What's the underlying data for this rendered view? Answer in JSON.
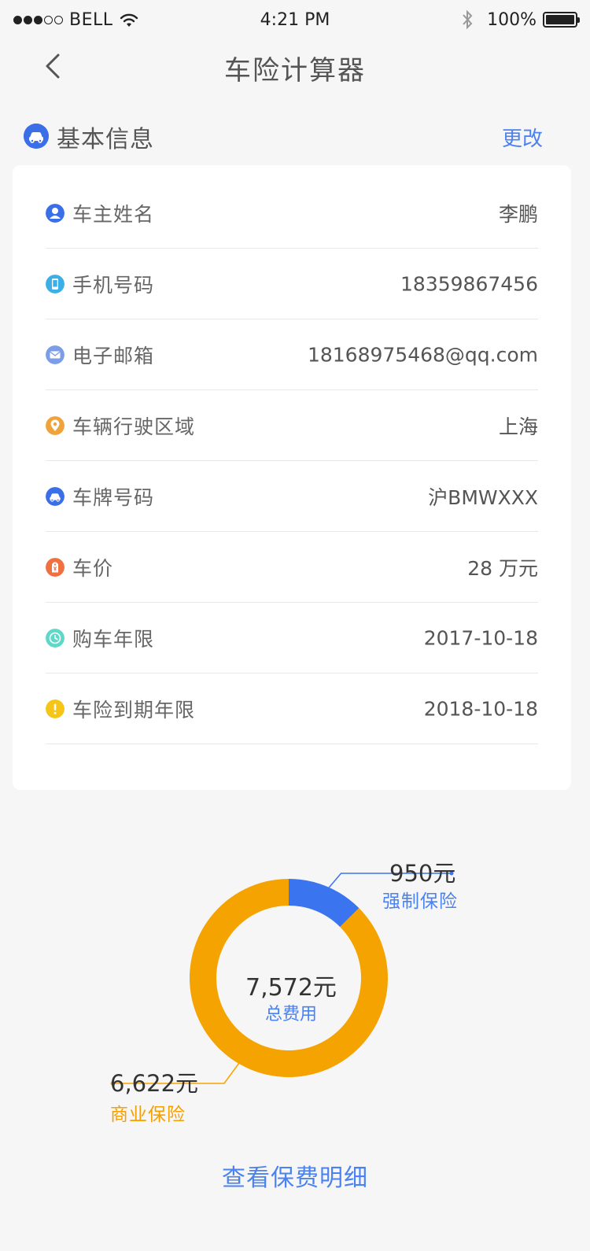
{
  "status_bar": {
    "carrier": "BELL",
    "time": "4:21 PM",
    "battery": "100%",
    "signal_filled": 3,
    "signal_total": 5
  },
  "nav": {
    "title": "车险计算器",
    "back_icon": "chevron-left-icon"
  },
  "section": {
    "title": "基本信息",
    "edit_label": "更改",
    "icon": "car-icon"
  },
  "rows": [
    {
      "label": "车主姓名",
      "value": "李鹏",
      "icon": "user-icon",
      "color": "#3a6fe8"
    },
    {
      "label": "手机号码",
      "value": "18359867456",
      "icon": "phone-icon",
      "color": "#3cb0e6"
    },
    {
      "label": "电子邮箱",
      "value": "18168975468@qq.com",
      "icon": "mail-icon",
      "color": "#7c9ee8"
    },
    {
      "label": "车辆行驶区域",
      "value": "上海",
      "icon": "location-pin-icon",
      "color": "#f0a33a"
    },
    {
      "label": "车牌号码",
      "value": "沪BMWXXX",
      "icon": "car-icon",
      "color": "#3a6fe8"
    },
    {
      "label": "车价",
      "value": "28 万元",
      "icon": "price-tag-icon",
      "color": "#f07040"
    },
    {
      "label": "购车年限",
      "value": "2017-10-18",
      "icon": "clock-icon",
      "color": "#5fd8c8"
    },
    {
      "label": "车险到期年限",
      "value": "2018-10-18",
      "icon": "warning-icon",
      "color": "#f5c518"
    }
  ],
  "chart": {
    "total_amount": "7,572元",
    "total_label": "总费用",
    "segments": [
      {
        "name": "强制保险",
        "amount_text": "950元",
        "value": 950,
        "color": "#3a74ee"
      },
      {
        "name": "商业保险",
        "amount_text": "6,622元",
        "value": 6622,
        "color": "#f5a300"
      }
    ]
  },
  "detail_link": "查看保费明细"
}
